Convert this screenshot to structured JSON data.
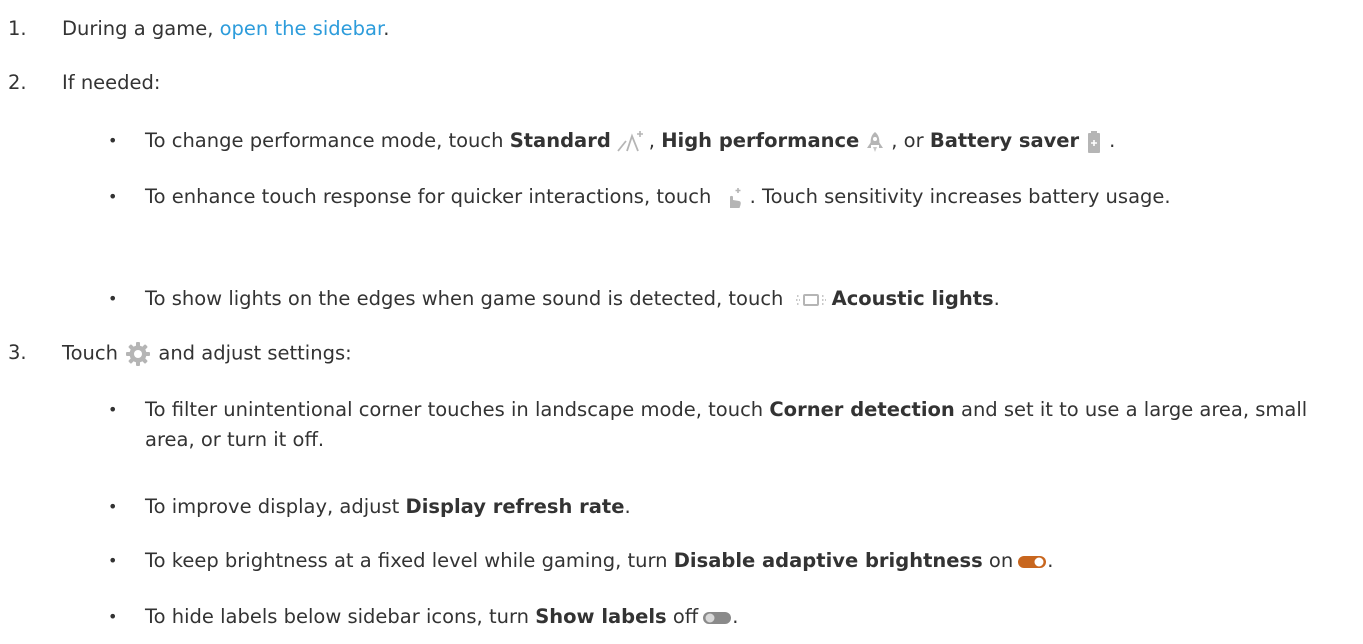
{
  "steps": [
    {
      "number": "1.",
      "text_before": "During a game, ",
      "link": "open the sidebar",
      "text_after": "."
    },
    {
      "number": "2.",
      "text": "If needed:",
      "bullets": [
        {
          "pre": "To change performance mode, touch ",
          "b1": "Standard",
          "icon1": "standard-mode-icon",
          "mid1": ", ",
          "b2": "High performance",
          "icon2": "rocket-icon",
          "mid2": ", or ",
          "b3": "Battery saver",
          "icon3": "battery-icon",
          "end": "."
        },
        {
          "pre": "To enhance touch response for quicker interactions, touch ",
          "icon": "touch-sensitivity-icon",
          "post": ". Touch sensitivity increases battery usage."
        },
        {
          "pre": "To show lights on the edges when game sound is detected, touch ",
          "icon": "acoustic-lights-icon",
          "b": "Acoustic lights",
          "end": "."
        }
      ]
    },
    {
      "number": "3.",
      "text_before": "Touch ",
      "icon": "settings-gear-icon",
      "text_after": " and adjust settings:",
      "bullets": [
        {
          "pre": "To filter unintentional corner touches in landscape mode, touch ",
          "b": "Corner detection",
          "post": " and set it to use a large area, small area, or turn it off."
        },
        {
          "pre": "To improve display, adjust ",
          "b": "Display refresh rate",
          "end": "."
        },
        {
          "pre": "To keep brightness at a fixed level while gaming, turn ",
          "b": "Disable adaptive brightness",
          "post": " on",
          "icon": "toggle-on-icon",
          "end": "."
        },
        {
          "pre": "To hide labels below sidebar icons, turn ",
          "b": "Show labels",
          "post": " off",
          "icon": "toggle-off-icon",
          "end": "."
        }
      ]
    }
  ],
  "bullet_glyph": "•",
  "colors": {
    "text": "#333333",
    "link": "#2d9cdb",
    "icon_gray": "#b5b5b5",
    "toggle_on": "#c8661e",
    "toggle_off": "#8a8a8a"
  }
}
